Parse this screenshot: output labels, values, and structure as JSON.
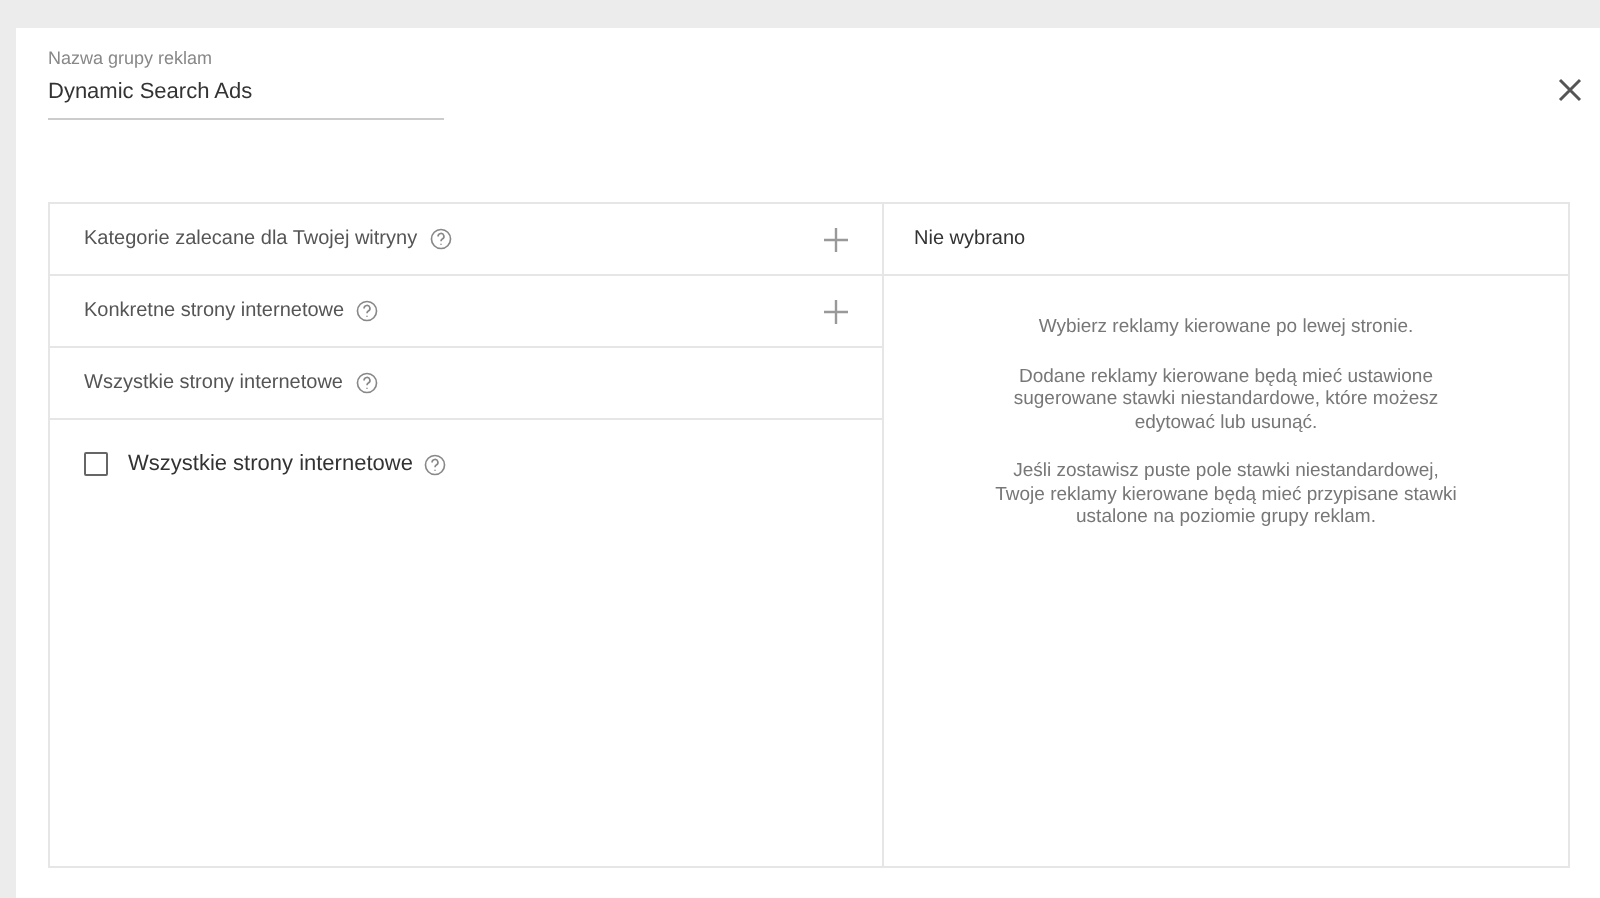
{
  "name_field": {
    "label": "Nazwa grupy reklam",
    "value": "Dynamic Search Ads"
  },
  "targets": [
    {
      "kind": "addable",
      "label": "Kategorie zalecane dla Twojej witryny"
    },
    {
      "kind": "addable",
      "label": "Konkretne strony internetowe"
    },
    {
      "kind": "group",
      "label": "Wszystkie strony internetowe",
      "options": [
        {
          "label": "Wszystkie strony internetowe",
          "checked": false
        }
      ]
    }
  ],
  "selection": {
    "title": "Nie wybrano",
    "messages": [
      "Wybierz reklamy kierowane po lewej stronie.",
      "Dodane reklamy kierowane będą mieć ustawione sugerowane stawki niestandardowe, które możesz edytować lub usunąć.",
      "Jeśli zostawisz puste pole stawki niestandardowej, Twoje reklamy kierowane będą mieć przypisane stawki ustalone na poziomie grupy reklam."
    ]
  }
}
